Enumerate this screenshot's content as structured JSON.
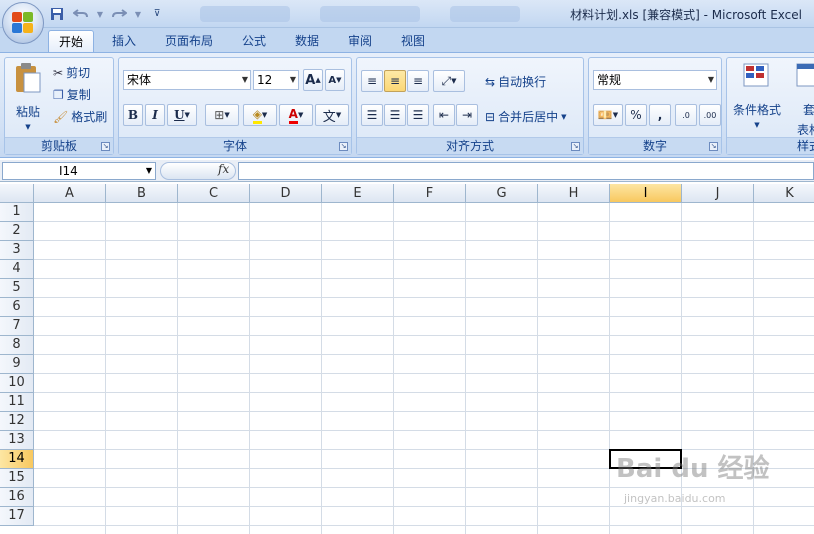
{
  "window": {
    "title": "材料计划.xls  [兼容模式] - Microsoft Excel"
  },
  "qat": {
    "save_icon": "save-icon",
    "undo_icon": "undo-icon",
    "redo_icon": "redo-icon",
    "customize_icon": "chevron-down-icon"
  },
  "tabs": [
    {
      "label": "开始",
      "active": true
    },
    {
      "label": "插入"
    },
    {
      "label": "页面布局"
    },
    {
      "label": "公式"
    },
    {
      "label": "数据"
    },
    {
      "label": "审阅"
    },
    {
      "label": "视图"
    }
  ],
  "ribbon": {
    "clipboard": {
      "label": "剪贴板",
      "paste": "粘贴",
      "cut": "剪切",
      "copy": "复制",
      "format_painter": "格式刷"
    },
    "font": {
      "label": "字体",
      "font_name": "宋体",
      "font_size": "12",
      "bold": "B",
      "italic": "I",
      "underline": "U",
      "grow": "A",
      "shrink": "A",
      "font_color_letter": "A",
      "phonetic": "文"
    },
    "alignment": {
      "label": "对齐方式",
      "wrap_text": "自动换行",
      "merge_center": "合并后居中"
    },
    "number": {
      "label": "数字",
      "format": "常规",
      "percent": "%",
      "comma": ",",
      "inc_decimal": ".0",
      "dec_decimal": ".00"
    },
    "styles": {
      "conditional_format": "条件格式",
      "table_format_1": "套",
      "table_format_2": "表格",
      "partial_label": "样式"
    }
  },
  "formula_bar": {
    "name_box": "I14",
    "fx": "fx",
    "value": ""
  },
  "sheet": {
    "columns": [
      "A",
      "B",
      "C",
      "D",
      "E",
      "F",
      "G",
      "H",
      "I",
      "J",
      "K"
    ],
    "rows": [
      "1",
      "2",
      "3",
      "4",
      "5",
      "6",
      "7",
      "8",
      "9",
      "10",
      "11",
      "12",
      "13",
      "14",
      "15",
      "16",
      "17"
    ],
    "selected_column": "I",
    "selected_row": "14"
  },
  "watermark": {
    "text": "Bai du 经验",
    "url": "jingyan.baidu.com"
  },
  "colors": {
    "accent": "#15428b",
    "selection": "#f8c85f",
    "ribbon": "#dbe7f7"
  }
}
